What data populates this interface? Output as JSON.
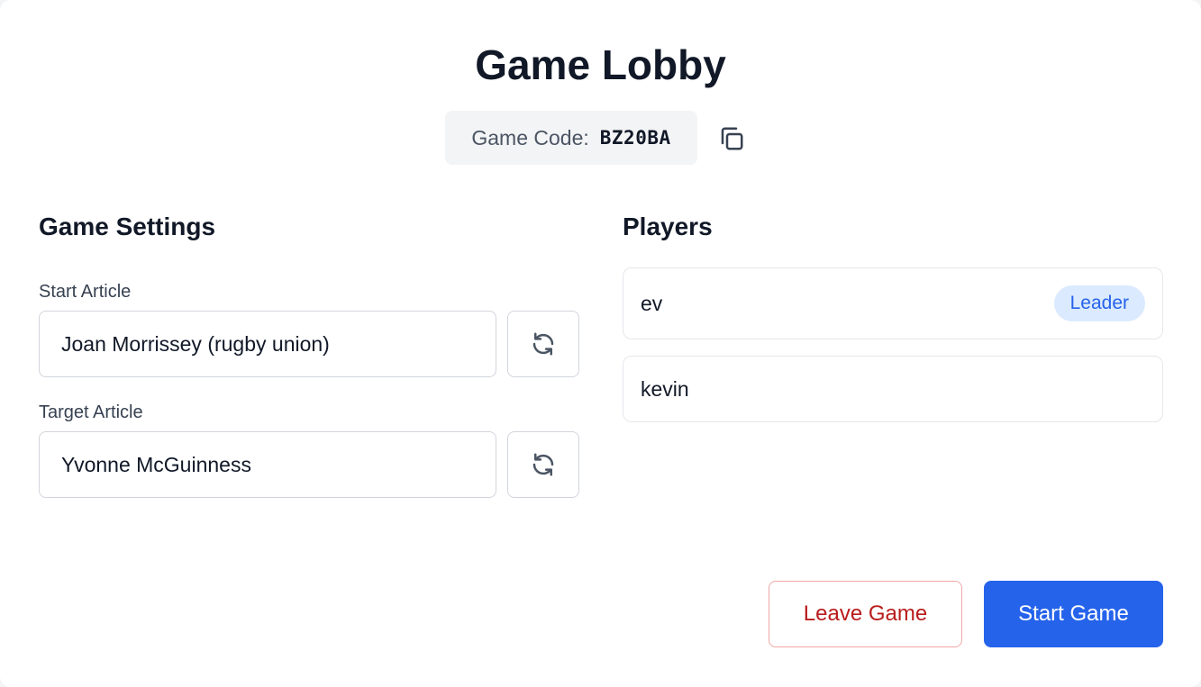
{
  "header": {
    "title": "Game Lobby",
    "game_code_label": "Game Code:",
    "game_code": "BZ20BA"
  },
  "settings": {
    "title": "Game Settings",
    "start_article_label": "Start Article",
    "start_article_value": "Joan Morrissey (rugby union)",
    "target_article_label": "Target Article",
    "target_article_value": "Yvonne McGuinness"
  },
  "players": {
    "title": "Players",
    "list": [
      {
        "name": "ev",
        "badge": "Leader"
      },
      {
        "name": "kevin",
        "badge": ""
      }
    ]
  },
  "actions": {
    "leave_label": "Leave Game",
    "start_label": "Start Game"
  },
  "colors": {
    "primary": "#2563eb",
    "danger": "#b91c1c",
    "badge_bg": "#dbeafe"
  },
  "icons": {
    "copy": "copy-icon",
    "refresh": "refresh-icon"
  }
}
